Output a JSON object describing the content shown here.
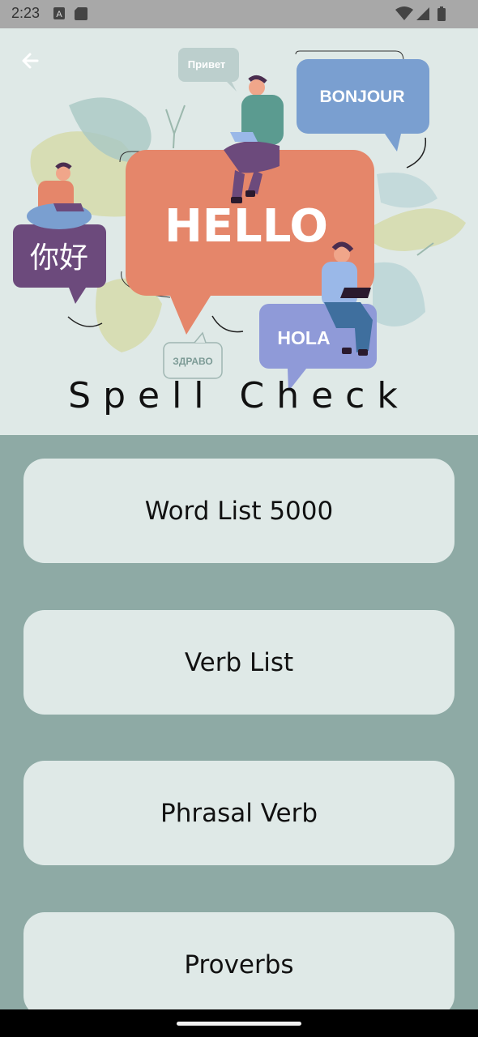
{
  "status_bar": {
    "time": "2:23",
    "left_icons": [
      "font-icon",
      "sd-card-icon"
    ],
    "right_icons": [
      "wifi-icon",
      "signal-icon",
      "battery-icon"
    ]
  },
  "header": {
    "back_icon": "arrow-left-icon",
    "title": "Spell Check",
    "greetings": {
      "hello": "HELLO",
      "bonjour": "BONJOUR",
      "hola": "HOLA",
      "privet": "Привет",
      "zdravo": "ЗДРАВО",
      "nihao": "你好"
    }
  },
  "menu": {
    "items": [
      {
        "label": "Word List 5000"
      },
      {
        "label": "Verb List"
      },
      {
        "label": "Phrasal Verb"
      },
      {
        "label": "Proverbs"
      }
    ]
  },
  "colors": {
    "header_bg": "#dfe9e7",
    "menu_bg": "#8eaaa5",
    "card_bg": "#dfe9e7",
    "hello_bubble": "#e5866a",
    "bonjour_bubble": "#7a9fd0",
    "hola_bubble": "#8f9ad8",
    "nihao_bubble": "#6c4a7c"
  }
}
